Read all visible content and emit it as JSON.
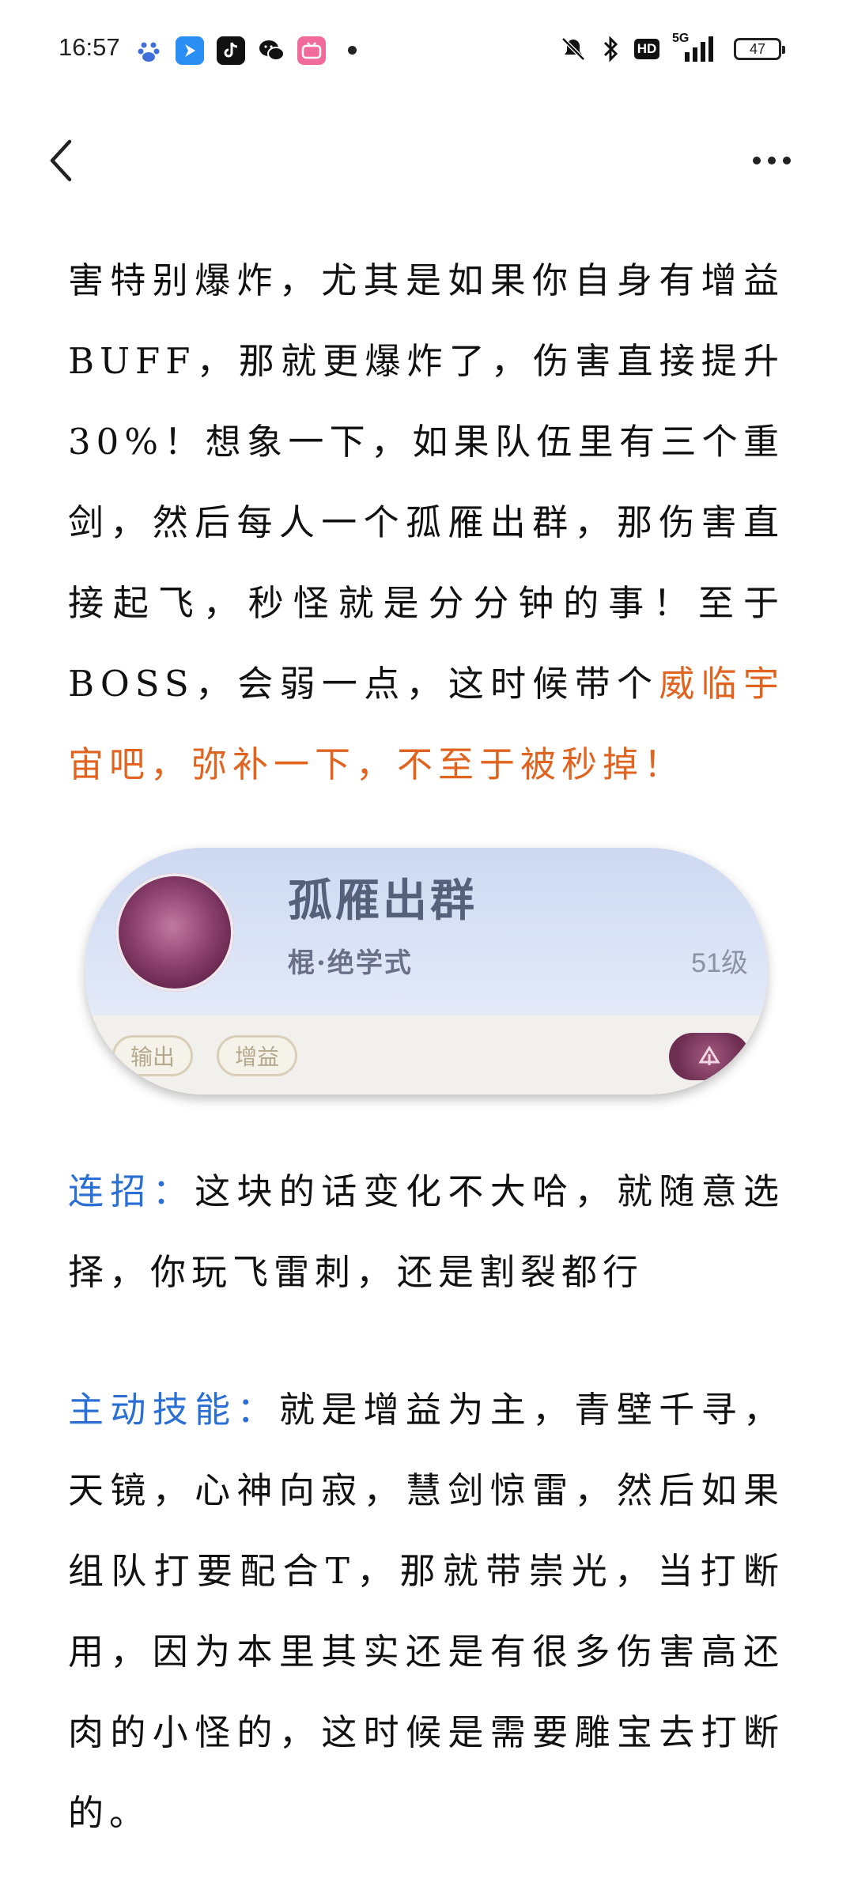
{
  "status_bar": {
    "time": "16:57",
    "battery": "47",
    "network": "5G",
    "hd": "HD",
    "icons": [
      "baidu-icon",
      "app-blue-icon",
      "tiktok-icon",
      "wechat-icon",
      "bilibili-icon",
      "mute-icon",
      "bluetooth-icon",
      "hd-icon",
      "signal-icon",
      "battery-icon"
    ]
  },
  "article": {
    "p1_a": "害特别爆炸，尤其是如果你自身有增益BUFF，那就更爆炸了，伤害直接提升30%！想象一下，如果队伍里有三个重剑，然后每人一个孤雁出群，那伤害直接起飞，秒怪就是分分钟的事！至于BOSS，会弱一点，这时候带个",
    "p1_b": "威临宇宙吧，弥补一下，不至于被秒掉！",
    "p2_label": "连招：",
    "p2_text": "这块的话变化不大哈，就随意选择，你玩飞雷刺，还是割裂都行",
    "p3_label": "主动技能：",
    "p3_text": "就是增益为主，青壁千寻，天镜，心神向寂，慧剑惊雷，然后如果组队打要配合T，那就带崇光，当打断用，因为本里其实还是有很多伤害高还肉的小怪的，这时候是需要雕宝去打断的。"
  },
  "skill_card": {
    "name": "孤雁出群",
    "type": "棍·绝学式",
    "level": "51级",
    "tags": [
      "输出",
      "增益"
    ]
  },
  "colors": {
    "accent_orange": "#e0631f",
    "accent_blue": "#2a6fd3"
  }
}
